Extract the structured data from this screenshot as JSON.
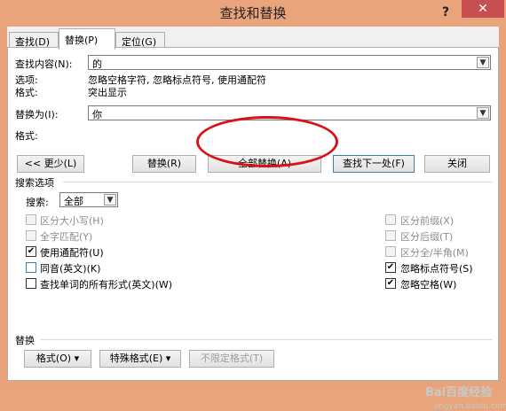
{
  "window": {
    "title": "查找和替换",
    "help_label": "?",
    "close_label": "✕"
  },
  "tabs": [
    {
      "label": "查找(D)"
    },
    {
      "label": "替换(P)"
    },
    {
      "label": "定位(G)"
    }
  ],
  "find": {
    "label": "查找内容(N):",
    "value": "的",
    "options_label": "选项:",
    "options_value": "忽略空格字符, 忽略标点符号, 使用通配符",
    "format_label": "格式:",
    "format_value": "突出显示"
  },
  "replace": {
    "label": "替换为(I):",
    "value": "你",
    "format_label": "格式:"
  },
  "buttons": {
    "less": "<< 更少(L)",
    "replace": "替换(R)",
    "replace_all": "全部替换(A)",
    "find_next": "查找下一处(F)",
    "close": "关闭"
  },
  "search_options": {
    "section_label": "搜索选项",
    "search_label": "搜索:",
    "search_value": "全部",
    "left": [
      {
        "label": "区分大小写(H)",
        "checked": false,
        "disabled": true
      },
      {
        "label": "全字匹配(Y)",
        "checked": false,
        "disabled": true
      },
      {
        "label": "使用通配符(U)",
        "checked": true,
        "disabled": false
      },
      {
        "label": "同音(英文)(K)",
        "checked": false,
        "disabled": false
      },
      {
        "label": "查找单词的所有形式(英文)(W)",
        "checked": false,
        "disabled": false
      }
    ],
    "right": [
      {
        "label": "区分前缀(X)",
        "checked": false,
        "disabled": true
      },
      {
        "label": "区分后缀(T)",
        "checked": false,
        "disabled": true
      },
      {
        "label": "区分全/半角(M)",
        "checked": false,
        "disabled": true
      },
      {
        "label": "忽略标点符号(S)",
        "checked": true,
        "disabled": false
      },
      {
        "label": "忽略空格(W)",
        "checked": true,
        "disabled": false
      }
    ]
  },
  "replace_section": {
    "label": "替换",
    "format_button": "格式(O) ▾",
    "special_button": "特殊格式(E) ▾",
    "no_format_button": "不限定格式(T)"
  },
  "watermark": {
    "main": "Bai百度经验",
    "sub": "jingyan.baidu.com"
  }
}
